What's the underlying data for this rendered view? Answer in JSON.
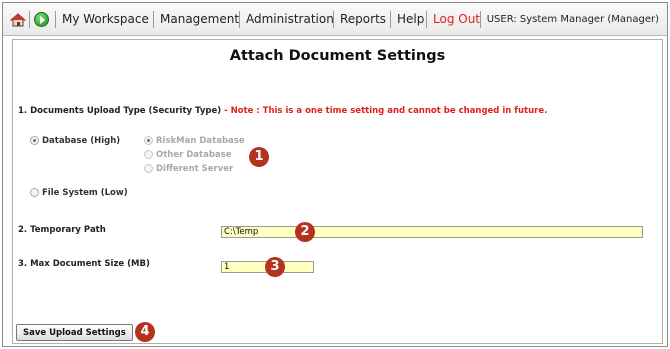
{
  "menubar": {
    "home_icon": "home-icon",
    "go_icon": "go-arrow-icon",
    "items": [
      "My Workspace",
      "Management",
      "Administration",
      "Reports",
      "Help",
      "Log Out"
    ],
    "user": "USER: System Manager (Manager)",
    "logout_color": "#e0201b"
  },
  "page": {
    "title": "Attach Document Settings"
  },
  "section1": {
    "label": "1. Documents Upload Type (Security Type)",
    "dash": " - ",
    "note": "Note : This is a one time setting and cannot be changed in future.",
    "options": {
      "database": "Database (High)",
      "riskman_db": "RiskMan Database",
      "other_db": "Other Database",
      "different_server": "Different Server",
      "file_system": "File System (Low)"
    },
    "selected": "Database (High)",
    "selected_sub": "RiskMan Database"
  },
  "section2": {
    "label": "2. Temporary Path",
    "value": "C:\\Temp"
  },
  "section3": {
    "label": "3. Max Document Size (MB)",
    "value": "1"
  },
  "save_button": "Save Upload Settings",
  "markers": [
    "1",
    "2",
    "3",
    "4"
  ],
  "colors": {
    "note": "#e0201b",
    "field_bg": "#ffffc0",
    "marker": "#b5321e"
  }
}
